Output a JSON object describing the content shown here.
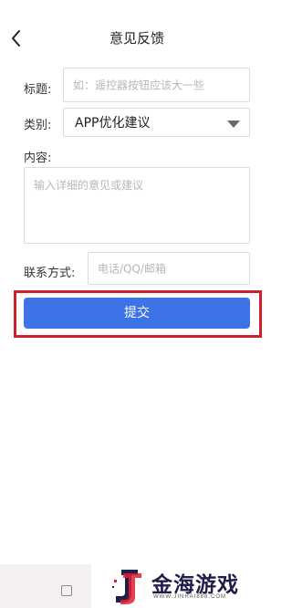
{
  "header": {
    "title": "意见反馈"
  },
  "form": {
    "title_label": "标题:",
    "title_placeholder": "如：遥控器按钮应该大一些",
    "category_label": "类别:",
    "category_value": "APP优化建议",
    "content_label": "内容:",
    "content_placeholder": "输入详细的意见或建议",
    "contact_label": "联系方式:",
    "contact_placeholder": "电话/QQ/邮箱",
    "submit_label": "提交"
  },
  "watermark": {
    "text": "金海游戏",
    "sub": "WWW.JINHAI888.COM"
  },
  "colors": {
    "accent": "#3d73e6",
    "highlight": "#d11e2c",
    "watermark_red": "#e2202f"
  },
  "icons": [
    "back-arrow-icon",
    "dropdown-caret-icon",
    "square-nav-icon",
    "watermark-logo-icon"
  ]
}
